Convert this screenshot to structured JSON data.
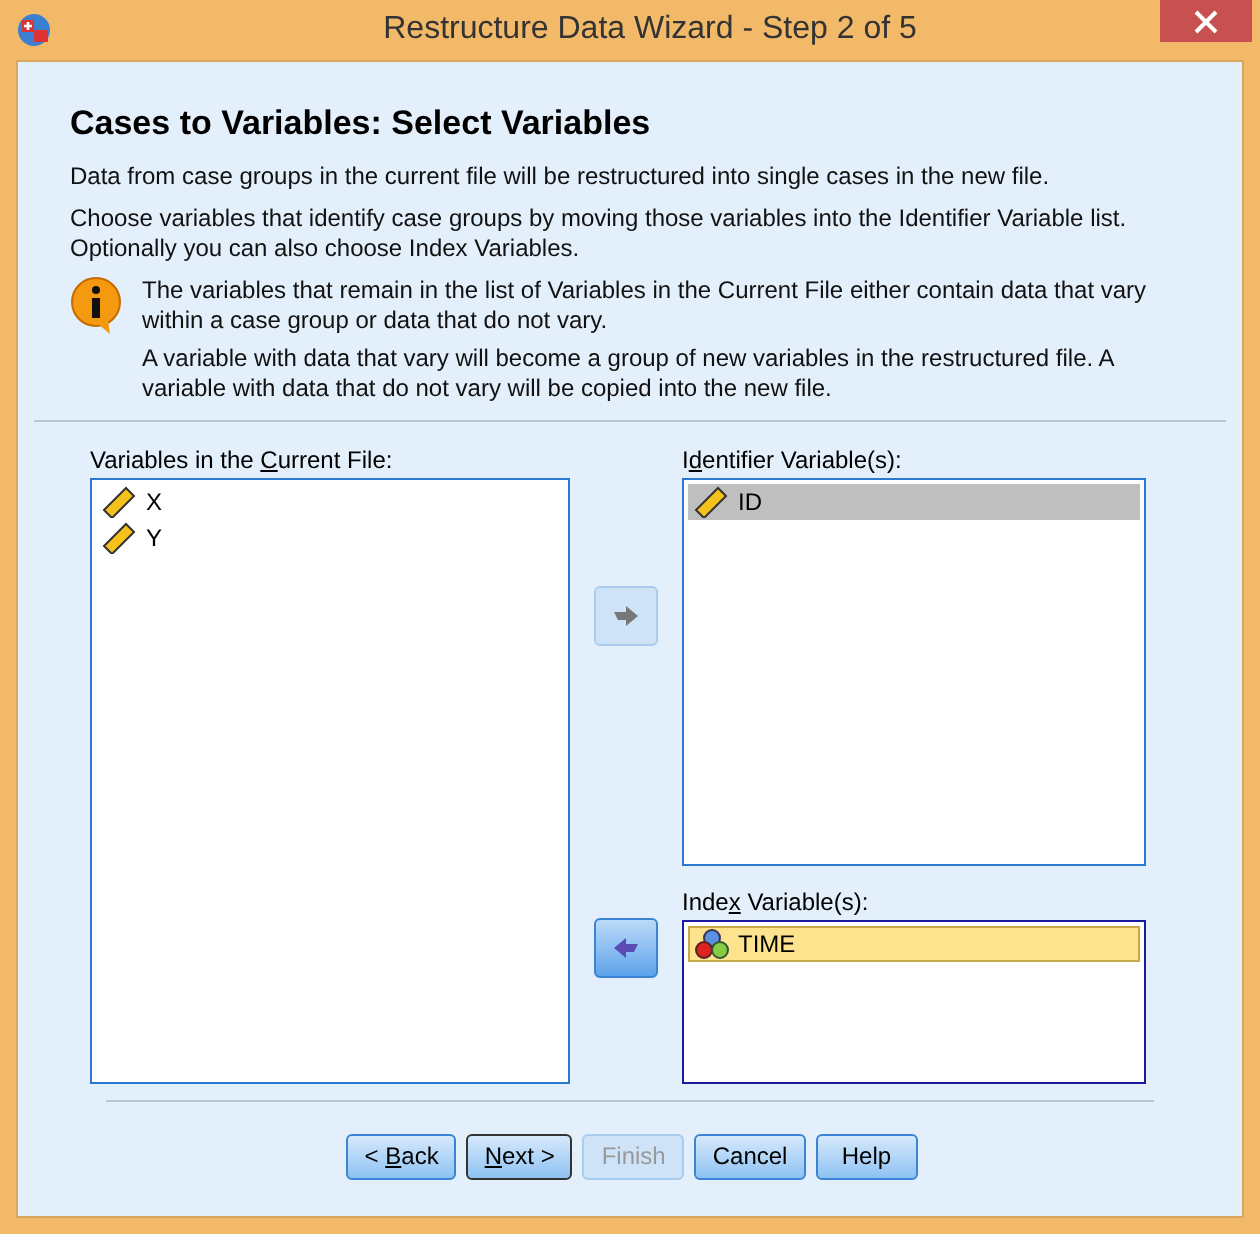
{
  "window": {
    "title": "Restructure Data Wizard - Step 2 of 5"
  },
  "heading": "Cases to Variables: Select Variables",
  "intro": [
    "Data from case groups in the current file will be restructured into single cases in the new file.",
    "Choose variables that identify case groups by moving those variables into the Identifier Variable list. Optionally you can also choose Index Variables."
  ],
  "info": [
    "The variables that remain in the list of Variables in the Current File either contain data that vary within a case group or data that do not vary.",
    "A variable with data that vary will become a group of new variables in the restructured file.  A variable with data that do not vary will be copied into the new file."
  ],
  "current_list": {
    "label": {
      "before": "Variables in the ",
      "key": "C",
      "after": "urrent File:"
    },
    "items": [
      {
        "name": "X",
        "kind": "scale",
        "selected": false
      },
      {
        "name": "Y",
        "kind": "scale",
        "selected": false
      }
    ]
  },
  "move_buttons": [
    {
      "kind": "move_right",
      "disabled": true
    },
    {
      "kind": "move_left",
      "disabled": false
    }
  ],
  "identifier_list": {
    "label": {
      "before": "I",
      "key": "d",
      "after": "entifier Variable(s):"
    },
    "focused": false,
    "items": [
      {
        "name": "ID",
        "kind": "scale",
        "selected": true,
        "focused": false
      }
    ]
  },
  "index_list": {
    "label": {
      "before": "Inde",
      "key": "x",
      "after": " Variable(s):"
    },
    "focused": true,
    "items": [
      {
        "name": "TIME",
        "kind": "nominal",
        "selected": true,
        "focused": true
      }
    ]
  },
  "buttons": [
    {
      "label": {
        "before": "< ",
        "key": "B",
        "after": "ack"
      },
      "disabled": false,
      "default": false
    },
    {
      "label": {
        "key": "N",
        "after": "ext >"
      },
      "disabled": false,
      "default": true
    },
    {
      "label": {
        "before": "Finish"
      },
      "disabled": true
    },
    {
      "label": {
        "before": "Cancel"
      },
      "disabled": false,
      "default": false
    },
    {
      "label": {
        "before": "Help"
      },
      "disabled": false,
      "default": false
    }
  ]
}
